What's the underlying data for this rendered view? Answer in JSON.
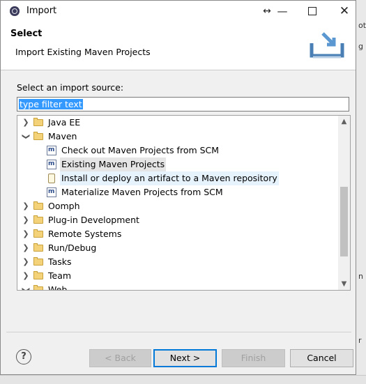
{
  "window": {
    "title": "Import"
  },
  "header": {
    "title": "Select",
    "description": "Import Existing Maven Projects"
  },
  "source": {
    "label": "Select an import source:",
    "filter_value": "type filter text"
  },
  "tree": {
    "items": [
      {
        "label": "Java EE",
        "expanded": false,
        "icon": "folder-icon"
      },
      {
        "label": "Maven",
        "expanded": true,
        "icon": "folder-icon"
      },
      {
        "label": "Check out Maven Projects from SCM",
        "icon": "maven-icon"
      },
      {
        "label": "Existing Maven Projects",
        "icon": "maven-icon",
        "selected": true
      },
      {
        "label": "Install or deploy an artifact to a Maven repository",
        "icon": "jar-icon"
      },
      {
        "label": "Materialize Maven Projects from SCM",
        "icon": "maven-icon"
      },
      {
        "label": "Oomph",
        "expanded": false,
        "icon": "folder-icon"
      },
      {
        "label": "Plug-in Development",
        "expanded": false,
        "icon": "folder-icon"
      },
      {
        "label": "Remote Systems",
        "expanded": false,
        "icon": "folder-icon"
      },
      {
        "label": "Run/Debug",
        "expanded": false,
        "icon": "folder-icon"
      },
      {
        "label": "Tasks",
        "expanded": false,
        "icon": "folder-icon"
      },
      {
        "label": "Team",
        "expanded": false,
        "icon": "folder-icon"
      },
      {
        "label": "Web",
        "expanded": true,
        "icon": "folder-icon"
      }
    ]
  },
  "buttons": {
    "help": "?",
    "back": "< Back",
    "next": "Next >",
    "finish": "Finish",
    "cancel": "Cancel"
  },
  "colors": {
    "selection": "#3399ff",
    "default_button_border": "#0078d7"
  }
}
